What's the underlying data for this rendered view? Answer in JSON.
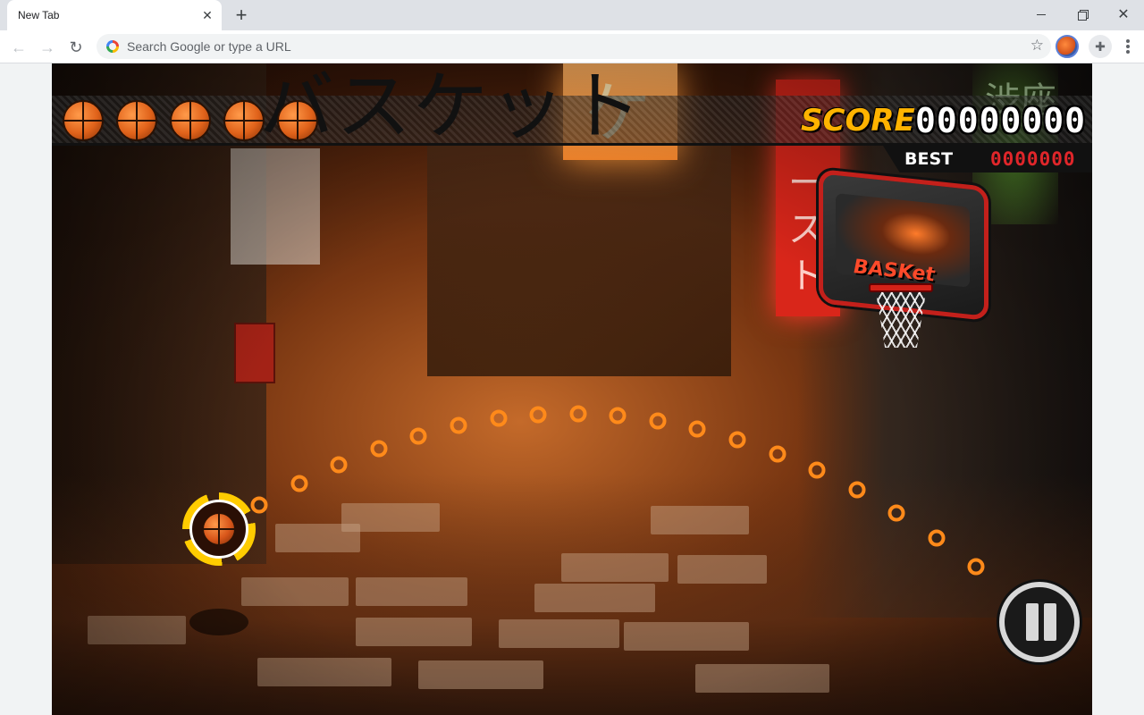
{
  "browser": {
    "tab_title": "New Tab",
    "tab_close": "✕",
    "new_tab": "+",
    "window_close": "✕",
    "back": "←",
    "forward": "→",
    "reload": "↻",
    "omnibox_placeholder": "Search Google or type a URL",
    "bookmark": "☆",
    "extensions": "✚"
  },
  "game": {
    "title": "バスケット",
    "lives_remaining": 5,
    "score_label": "SCORE",
    "score_value": "00000000",
    "best_label": "BEST",
    "best_value": "0000000",
    "backboard_tag": "BASKet",
    "signs": {
      "orange": "ケ",
      "red": "ースト",
      "green": "渋座"
    },
    "colors": {
      "score_label": "#ffb300",
      "best_value": "#e0262a",
      "ball": "#e0621a",
      "trajectory": "#ff8a1a",
      "ring": "#ffcc00"
    },
    "icons": {
      "lives": "basketball-icon",
      "pause": "pause-icon"
    }
  }
}
